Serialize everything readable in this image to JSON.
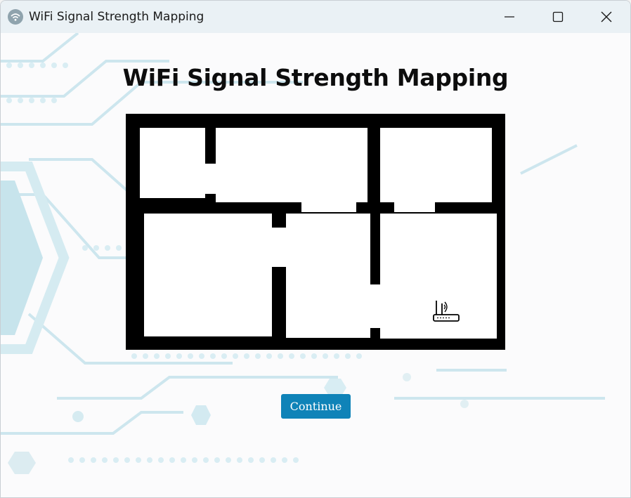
{
  "window": {
    "title": "WiFi Signal Strength Mapping",
    "app_icon": "wifi-icon",
    "controls": [
      "minimize-icon",
      "maximize-icon",
      "close-icon"
    ]
  },
  "main": {
    "heading": "WiFi Signal Strength Mapping",
    "floorplan_router_icon": "router-icon",
    "continue_label": "Continue"
  },
  "colors": {
    "accent": "#0f83b8",
    "titlebar": "#eaf1f5",
    "wall": "#000000",
    "circuit_bg": "#c9e4ec"
  }
}
